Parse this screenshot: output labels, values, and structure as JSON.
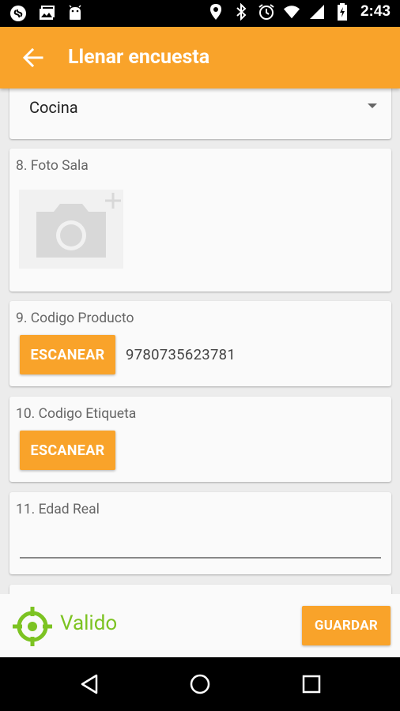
{
  "status_bar": {
    "time": "2:43",
    "left_icons": [
      "shazam-icon",
      "photo-upload-icon",
      "android-icon"
    ],
    "right_icons": [
      "location-icon",
      "bluetooth-icon",
      "alarm-icon",
      "wifi-icon",
      "signal-icon",
      "battery-charging-icon"
    ]
  },
  "app_bar": {
    "title": "Llenar encuesta",
    "back_icon": "arrow-back-icon",
    "color": "#f9a32a"
  },
  "questions": {
    "q7": {
      "selected_value": "Cocina"
    },
    "q8": {
      "label": "8. Foto Sala",
      "icon": "add-photo-icon"
    },
    "q9": {
      "label": "9. Codigo Producto",
      "button_label": "ESCANEAR",
      "value": "9780735623781"
    },
    "q10": {
      "label": "10. Codigo Etiqueta",
      "button_label": "ESCANEAR",
      "value": ""
    },
    "q11": {
      "label": "11. Edad Real",
      "value": ""
    }
  },
  "footer": {
    "status_icon": "gps-target-icon",
    "status_text": "Valido",
    "status_color": "#7cc322",
    "save_label": "GUARDAR"
  },
  "nav_bar": {
    "icons": [
      "back-triangle-icon",
      "home-circle-icon",
      "recents-square-icon"
    ]
  }
}
